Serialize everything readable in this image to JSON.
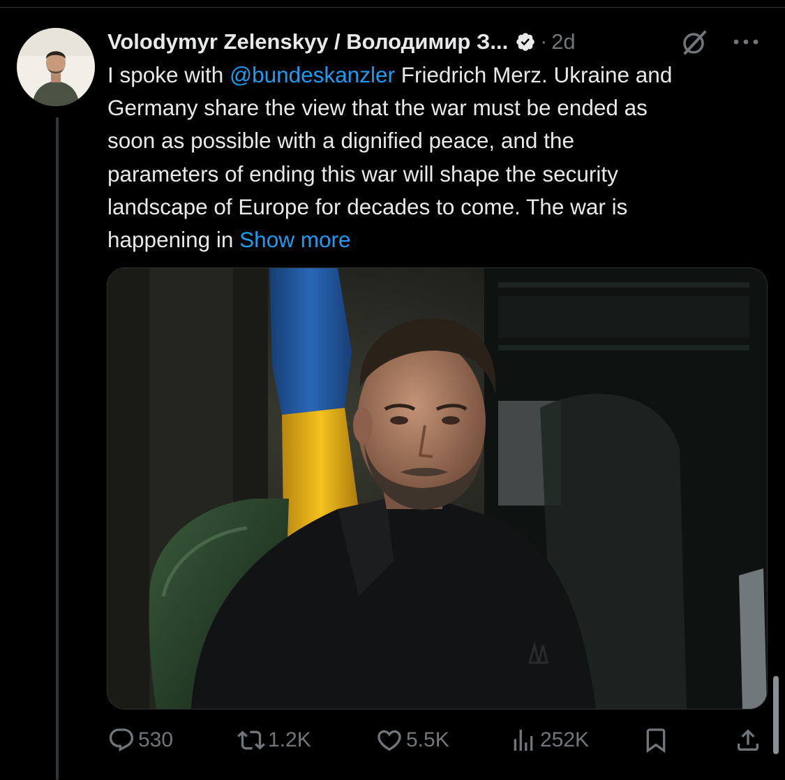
{
  "tweet": {
    "author_name": "Volodymyr Zelenskyy / Володимир З...",
    "separator": "·",
    "time": "2d",
    "text_lines": [
      [
        "I spoke with ",
        "@bundeskanzler",
        " Friedrich Merz. Ukraine and"
      ],
      "Germany share the view that the war must be ended as",
      "soon as possible with a dignified peace, and the",
      "parameters of ending this war will shape the security",
      "landscape of Europe for decades to come. The war is",
      [
        "happening in ",
        "Show more"
      ]
    ],
    "text": {
      "line1_prefix": "I spoke with ",
      "mention": "@bundeskanzler",
      "line1_suffix": " Friedrich Merz. Ukraine and",
      "line2": "Germany share the view that the war must be ended as",
      "line3": "soon as possible with a dignified peace, and the",
      "line4": "parameters of ending this war will shape the security",
      "line5": "landscape of Europe for decades to come. The war is",
      "line6_prefix": "happening in ",
      "show_more": "Show more"
    }
  },
  "actions": {
    "replies": "530",
    "reposts": "1.2K",
    "likes": "5.5K",
    "views": "252K"
  },
  "icons": {
    "verified": "verified-badge-icon",
    "grok": "grok-icon",
    "more": "more-options-icon",
    "reply": "reply-icon",
    "repost": "repost-icon",
    "like": "like-icon",
    "views": "views-icon",
    "bookmark": "bookmark-icon",
    "share": "share-icon"
  },
  "colors": {
    "background": "#000000",
    "text": "#e7e9ea",
    "secondary_text": "#71767b",
    "link": "#1d9bf0",
    "flag_blue": "#1f5fb0",
    "flag_yellow": "#f4c21f"
  }
}
